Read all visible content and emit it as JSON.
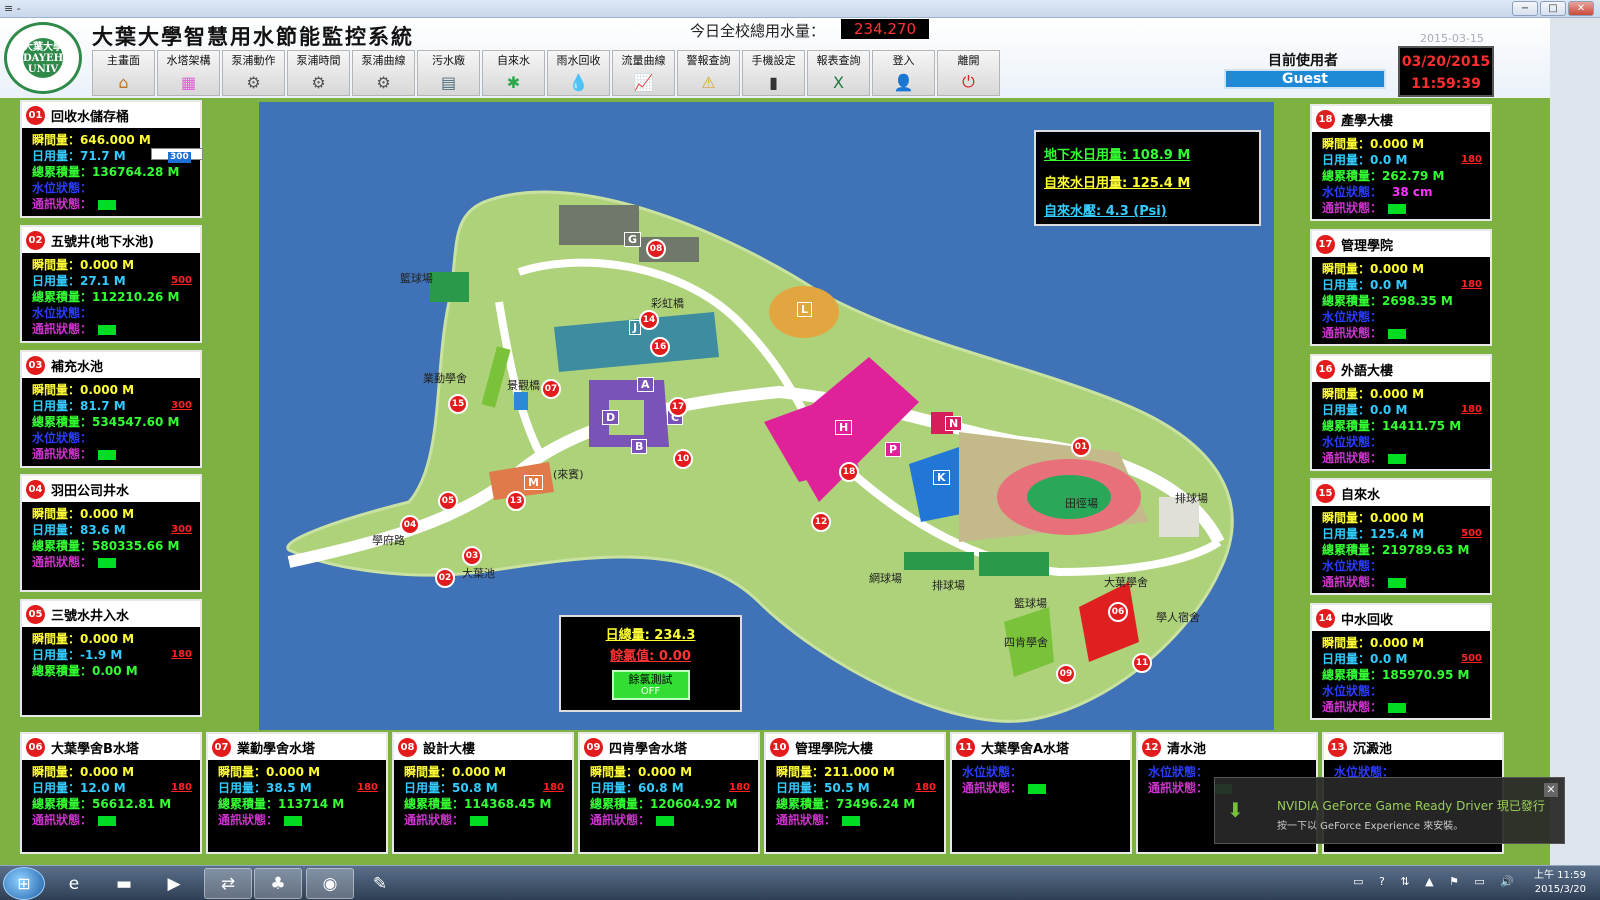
{
  "window": {
    "system_menu": "≡ -",
    "min": "−",
    "max": "□",
    "close": "✕"
  },
  "header": {
    "logo_text": "大葉大學 DAYEH UNIV",
    "title": "大葉大學智慧用水節能監控系統",
    "total_label": "今日全校總用水量：",
    "total_value": "234.270",
    "date_small": "2015-03-15",
    "user_label": "目前使用者",
    "user_name": "Guest",
    "clock_date": "03/20/2015",
    "clock_time": "11:59:39"
  },
  "toolbar": [
    {
      "label": "主畫面",
      "icon": "home-icon",
      "glyph": "⌂",
      "color": "#c0762a"
    },
    {
      "label": "水塔架構",
      "icon": "tower-icon",
      "glyph": "▦",
      "color": "#e05ad8"
    },
    {
      "label": "泵浦動作",
      "icon": "pump-icon",
      "glyph": "⚙",
      "color": "#555555"
    },
    {
      "label": "泵浦時間",
      "icon": "pump-time-icon",
      "glyph": "⚙",
      "color": "#555555"
    },
    {
      "label": "泵浦曲線",
      "icon": "pump-curve-icon",
      "glyph": "⚙",
      "color": "#555555"
    },
    {
      "label": "污水廠",
      "icon": "sewage-icon",
      "glyph": "▤",
      "color": "#4a6a7a"
    },
    {
      "label": "自來水",
      "icon": "tapwater-icon",
      "glyph": "✱",
      "color": "#2aa84a"
    },
    {
      "label": "雨水回收",
      "icon": "rain-icon",
      "glyph": "💧",
      "color": "#2a8ad6"
    },
    {
      "label": "流量曲線",
      "icon": "flow-chart-icon",
      "glyph": "📈",
      "color": "#2a9a4a"
    },
    {
      "label": "警報查詢",
      "icon": "alarm-icon",
      "glyph": "⚠",
      "color": "#d6a62a"
    },
    {
      "label": "手機設定",
      "icon": "phone-icon",
      "glyph": "▮",
      "color": "#333333"
    },
    {
      "label": "報表查詢",
      "icon": "excel-icon",
      "glyph": "X",
      "color": "#1f7a3a"
    },
    {
      "label": "登入",
      "icon": "user-login-icon",
      "glyph": "👤",
      "color": "#c07a3a"
    },
    {
      "label": "離開",
      "icon": "power-icon",
      "glyph": "⏻",
      "color": "#d82020"
    }
  ],
  "labels": {
    "inst": "瞬間量：",
    "day": "日用量：",
    "total": "總累積量：",
    "level": "水位狀態：",
    "comm": "通訊狀態："
  },
  "panels_left": [
    {
      "num": "01",
      "title": "回收水儲存桶",
      "inst": "646.000 M",
      "day": "71.7 M",
      "total": "136764.28 M",
      "level": "",
      "input_val": "300"
    },
    {
      "num": "02",
      "title": "五號井(地下水池)",
      "inst": "0.000 M",
      "day": "27.1 M",
      "total": "112210.26 M",
      "level": "",
      "limit": "500"
    },
    {
      "num": "03",
      "title": "補充水池",
      "inst": "0.000 M",
      "day": "81.7 M",
      "total": "534547.60 M",
      "level": "",
      "limit": "300"
    },
    {
      "num": "04",
      "title": "羽田公司井水",
      "inst": "0.000 M",
      "day": "83.6 M",
      "total": "580335.66 M",
      "limit": "300"
    },
    {
      "num": "05",
      "title": "三號水井入水",
      "inst": "0.000 M",
      "day": "-1.9 M",
      "total": "0.00 M",
      "limit": "180"
    }
  ],
  "panels_right": [
    {
      "num": "18",
      "title": "產學大樓",
      "inst": "0.000 M",
      "day": "0.0 M",
      "total": "262.79 M",
      "level": "38 cm",
      "limit": "180"
    },
    {
      "num": "17",
      "title": "管理學院",
      "inst": "0.000 M",
      "day": "0.0 M",
      "total": "2698.35 M",
      "level": "",
      "limit": "180"
    },
    {
      "num": "16",
      "title": "外語大樓",
      "inst": "0.000 M",
      "day": "0.0 M",
      "total": "14411.75 M",
      "level": "",
      "limit": "180"
    },
    {
      "num": "15",
      "title": "自來水",
      "inst": "0.000 M",
      "day": "125.4 M",
      "total": "219789.63 M",
      "level": "",
      "limit": "500"
    },
    {
      "num": "14",
      "title": "中水回收",
      "inst": "0.000 M",
      "day": "0.0 M",
      "total": "185970.95 M",
      "level": "",
      "limit": "500"
    }
  ],
  "panels_bottom": [
    {
      "num": "06",
      "title": "大葉學舍B水塔",
      "inst": "0.000 M",
      "day": "12.0 M",
      "total": "56612.81 M",
      "limit": "180"
    },
    {
      "num": "07",
      "title": "業勤學舍水塔",
      "inst": "0.000 M",
      "day": "38.5 M",
      "total": "113714 M",
      "limit": "180"
    },
    {
      "num": "08",
      "title": "設計大樓",
      "inst": "0.000 M",
      "day": "50.8 M",
      "total": "114368.45 M",
      "limit": "180"
    },
    {
      "num": "09",
      "title": "四肯學舍水塔",
      "inst": "0.000 M",
      "day": "60.8 M",
      "total": "120604.92 M",
      "limit": "180"
    },
    {
      "num": "10",
      "title": "管理學院大樓",
      "inst": "211.000 M",
      "day": "50.5 M",
      "total": "73496.24 M",
      "limit": "180"
    },
    {
      "num": "11",
      "title": "大葉學舍A水塔"
    },
    {
      "num": "12",
      "title": "清水池"
    },
    {
      "num": "13",
      "title": "沉澱池"
    }
  ],
  "map": {
    "groundwater": "地下水日用量: 108.9 M",
    "tapwater": "自來水日用量: 125.4 M",
    "pressure": "自來水壓:  4.3 (Psi)",
    "day_total": "日總量: 234.3",
    "chlorine": "餘氯值: 0.00",
    "test_label": "餘氯測試",
    "test_state": "OFF",
    "place_labels": [
      "籃球場",
      "彩虹橋",
      "業勤學舍",
      "景觀橋",
      "(來賓)",
      "田徑場",
      "排球場",
      "網球場",
      "排球場",
      "籃球場",
      "大葉學舍",
      "學人宿舍",
      "四肯學舍",
      "學府路",
      "大葉池"
    ],
    "buildings": [
      "G",
      "J",
      "L",
      "A",
      "B",
      "C",
      "D",
      "H",
      "P",
      "N",
      "K",
      "M"
    ],
    "markers": [
      "08",
      "14",
      "16",
      "07",
      "17",
      "15",
      "10",
      "18",
      "12",
      "01",
      "05",
      "13",
      "04",
      "03",
      "02",
      "06",
      "11",
      "09"
    ]
  },
  "notification": {
    "title": "NVIDIA GeForce Game Ready Driver 現已發行",
    "subtitle": "按一下以 GeForce Experience 來安裝。",
    "close": "✕"
  },
  "taskbar": {
    "start": "⊞",
    "apps": [
      {
        "name": "ie-icon",
        "glyph": "e"
      },
      {
        "name": "folder-icon",
        "glyph": "▬"
      },
      {
        "name": "media-player-icon",
        "glyph": "▶"
      },
      {
        "name": "teamviewer-icon",
        "glyph": "⇄"
      },
      {
        "name": "green-app-icon",
        "glyph": "♣"
      },
      {
        "name": "nvidia-icon",
        "glyph": "◉"
      },
      {
        "name": "paint-icon",
        "glyph": "✎"
      }
    ],
    "tray": "▭ ? ⇅ ▲ ⚑ ▭ 🔊",
    "time": "上午 11:59",
    "date": "2015/3/20"
  }
}
